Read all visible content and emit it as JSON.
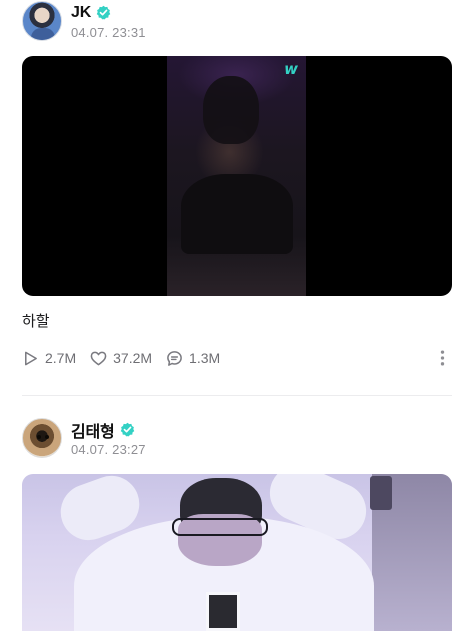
{
  "posts": [
    {
      "author": "JK",
      "time": "04.07. 23:31",
      "video_logo": "w",
      "text": "하할",
      "stats": {
        "plays": "2.7M",
        "likes": "37.2M",
        "comments": "1.3M"
      }
    },
    {
      "author": "김태형",
      "time": "04.07. 23:27"
    }
  ],
  "icons": {
    "verified": "verified-badge-icon",
    "play": "play-icon",
    "like": "heart-icon",
    "comment": "comment-icon",
    "more": "more-vertical-icon"
  },
  "colors": {
    "verified_badge": "#33d1c4",
    "text_primary": "#1c1c1e",
    "text_secondary": "#8e8e93",
    "divider": "#ececee"
  }
}
